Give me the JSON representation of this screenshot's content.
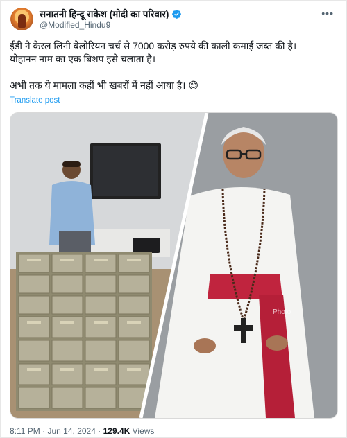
{
  "author": {
    "display_name": "सनातनी हिन्दू राकेश (मोदी का परिवार)",
    "handle": "@Modified_Hindu9",
    "verified": true
  },
  "tweet": {
    "line1": "ईडी ने केरल लिनी बेलोरियन चर्च से 7000 करोड़ रुपये की काली कमाई जब्त की है।",
    "line2": "योहानन नाम का एक बिशप इसे चलाता है।",
    "line3": "अभी तक ये मामला कहीं भी खबरों में नहीं आया है। 😊",
    "translate_label": "Translate post"
  },
  "media": {
    "watermark": "Photo"
  },
  "meta": {
    "time": "8:11 PM",
    "separator": "·",
    "date": "Jun 14, 2024",
    "views_count": "129.4K",
    "views_label": "Views"
  },
  "colors": {
    "link": "#1d9bf0",
    "verified": "#1d9bf0",
    "secondary_text": "#536471",
    "primary_text": "#0f1419"
  },
  "icons": {
    "verified": "verified-badge-icon",
    "more": "more-options-icon"
  }
}
